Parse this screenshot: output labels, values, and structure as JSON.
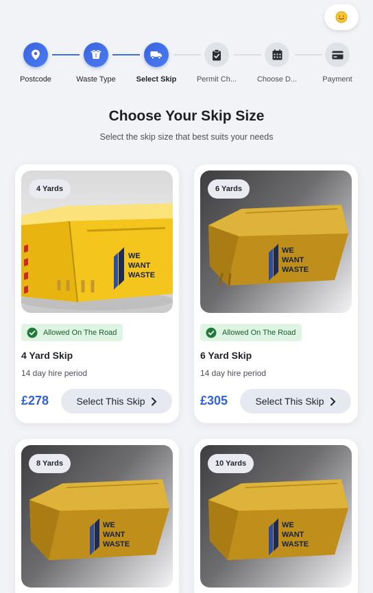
{
  "stepper": {
    "steps": [
      {
        "label": "Postcode",
        "icon": "map-pin-icon",
        "state": "done"
      },
      {
        "label": "Waste Type",
        "icon": "trash-icon",
        "state": "done"
      },
      {
        "label": "Select Skip",
        "icon": "truck-icon",
        "state": "current"
      },
      {
        "label": "Permit Ch...",
        "icon": "clipboard-check-icon",
        "state": "pending"
      },
      {
        "label": "Choose D...",
        "icon": "calendar-icon",
        "state": "pending"
      },
      {
        "label": "Payment",
        "icon": "credit-card-icon",
        "state": "pending"
      }
    ]
  },
  "header": {
    "title": "Choose Your Skip Size",
    "subtitle": "Select the skip size that best suits your needs"
  },
  "skips": [
    {
      "size_label": "4 Yards",
      "road_label": "Allowed On The Road",
      "title": "4 Yard Skip",
      "hire": "14 day hire period",
      "price": "£278",
      "button": "Select This Skip",
      "logo": [
        "WE",
        "WANT",
        "WASTE"
      ]
    },
    {
      "size_label": "6 Yards",
      "road_label": "Allowed On The Road",
      "title": "6 Yard Skip",
      "hire": "14 day hire period",
      "price": "£305",
      "button": "Select This Skip",
      "logo": [
        "WE",
        "WANT",
        "WASTE"
      ]
    },
    {
      "size_label": "8 Yards",
      "logo": [
        "WE",
        "WANT",
        "WASTE"
      ]
    },
    {
      "size_label": "10 Yards",
      "logo": [
        "WE",
        "WANT",
        "WASTE"
      ]
    }
  ],
  "colors": {
    "accent": "#3b6fe0",
    "price": "#3160d8",
    "road_badge_bg": "#dff5e3",
    "road_badge_icon": "#1f7a3a",
    "skip_yellow": "#f2c21a",
    "skip_ochre": "#c99a22"
  },
  "theme_toggle": {
    "icon": "sun-smiley-icon"
  }
}
